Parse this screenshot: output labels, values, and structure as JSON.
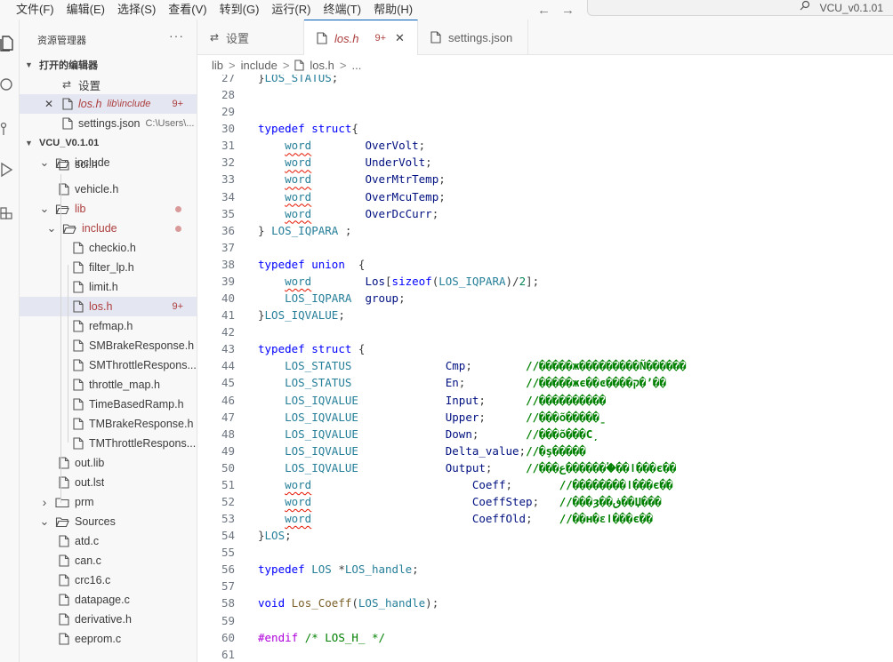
{
  "menu": [
    "文件(F)",
    "编辑(E)",
    "选择(S)",
    "查看(V)",
    "转到(G)",
    "运行(R)",
    "终端(T)",
    "帮助(H)"
  ],
  "nav": {
    "back": "←",
    "forward": "→"
  },
  "command_center": {
    "text": "VCU_v0.1.01"
  },
  "sidebar": {
    "title": "资源管理器",
    "more": "···",
    "open_editors_title": "打开的编辑器",
    "open_editors": [
      {
        "close": "",
        "icon": "gear-icon",
        "name": "设置",
        "desc": "",
        "badge": ""
      },
      {
        "close": "✕",
        "icon": "file-icon",
        "name": "los.h",
        "desc": "lib\\include",
        "badge": "9+"
      },
      {
        "close": "",
        "icon": "file-icon",
        "name": "settings.json",
        "desc": "C:\\Users\\...",
        "badge": ""
      }
    ],
    "project_title": "VCU_V0.1.01",
    "tree": [
      {
        "type": "folder",
        "open": true,
        "level": 1,
        "name": "include",
        "badge": "",
        "dot": false,
        "modified": false,
        "active": false
      },
      {
        "type": "file",
        "level": 2,
        "name": "sci.h",
        "badge": "",
        "modified": false,
        "active": false,
        "clipped": true
      },
      {
        "type": "file",
        "level": 2,
        "name": "vehicle.h",
        "badge": "",
        "modified": false,
        "active": false
      },
      {
        "type": "folder",
        "open": true,
        "level": 1,
        "name": "lib",
        "badge": "",
        "dot": true,
        "modified": true,
        "active": false
      },
      {
        "type": "folder",
        "open": true,
        "level": 2,
        "name": "include",
        "badge": "",
        "dot": true,
        "modified": true,
        "active": false
      },
      {
        "type": "file",
        "level": 3,
        "name": "checkio.h",
        "badge": "",
        "modified": false,
        "active": false
      },
      {
        "type": "file",
        "level": 3,
        "name": "filter_lp.h",
        "badge": "",
        "modified": false,
        "active": false
      },
      {
        "type": "file",
        "level": 3,
        "name": "limit.h",
        "badge": "",
        "modified": false,
        "active": false
      },
      {
        "type": "file",
        "level": 3,
        "name": "los.h",
        "badge": "9+",
        "modified": true,
        "active": true
      },
      {
        "type": "file",
        "level": 3,
        "name": "refmap.h",
        "badge": "",
        "modified": false,
        "active": false
      },
      {
        "type": "file",
        "level": 3,
        "name": "SMBrakeResponse.h",
        "badge": "",
        "modified": false,
        "active": false
      },
      {
        "type": "file",
        "level": 3,
        "name": "SMThrottleRespons...",
        "badge": "",
        "modified": false,
        "active": false
      },
      {
        "type": "file",
        "level": 3,
        "name": "throttle_map.h",
        "badge": "",
        "modified": false,
        "active": false
      },
      {
        "type": "file",
        "level": 3,
        "name": "TimeBasedRamp.h",
        "badge": "",
        "modified": false,
        "active": false
      },
      {
        "type": "file",
        "level": 3,
        "name": "TMBrakeResponse.h",
        "badge": "",
        "modified": false,
        "active": false
      },
      {
        "type": "file",
        "level": 3,
        "name": "TMThrottleRespons...",
        "badge": "",
        "modified": false,
        "active": false
      },
      {
        "type": "file",
        "level": 2,
        "name": "out.lib",
        "badge": "",
        "modified": false,
        "active": false
      },
      {
        "type": "file",
        "level": 2,
        "name": "out.lst",
        "badge": "",
        "modified": false,
        "active": false
      },
      {
        "type": "folder",
        "open": false,
        "level": 1,
        "name": "prm",
        "badge": "",
        "dot": false,
        "modified": false,
        "active": false
      },
      {
        "type": "folder",
        "open": true,
        "level": 1,
        "name": "Sources",
        "badge": "",
        "dot": false,
        "modified": false,
        "active": false
      },
      {
        "type": "file",
        "level": 2,
        "name": "atd.c",
        "badge": "",
        "modified": false,
        "active": false
      },
      {
        "type": "file",
        "level": 2,
        "name": "can.c",
        "badge": "",
        "modified": false,
        "active": false
      },
      {
        "type": "file",
        "level": 2,
        "name": "crc16.c",
        "badge": "",
        "modified": false,
        "active": false
      },
      {
        "type": "file",
        "level": 2,
        "name": "datapage.c",
        "badge": "",
        "modified": false,
        "active": false
      },
      {
        "type": "file",
        "level": 2,
        "name": "derivative.h",
        "badge": "",
        "modified": false,
        "active": false
      },
      {
        "type": "file",
        "level": 2,
        "name": "eeprom.c",
        "badge": "",
        "modified": false,
        "active": false
      }
    ]
  },
  "tabs": [
    {
      "name": "设置",
      "icon": "gear-icon",
      "badge": "",
      "close": "",
      "active": false
    },
    {
      "name": "los.h",
      "icon": "file-icon",
      "badge": "9+",
      "close": "✕",
      "active": true
    },
    {
      "name": "settings.json",
      "icon": "file-icon",
      "badge": "",
      "close": "",
      "active": false
    }
  ],
  "breadcrumb": [
    "lib",
    ">",
    "include",
    ">",
    "los.h",
    ">",
    "..."
  ],
  "code_lines": [
    {
      "n": "27",
      "t": [
        [
          "plain",
          "}"
        ],
        [
          "type",
          "LOS_STATUS"
        ],
        [
          "plain",
          ";"
        ]
      ]
    },
    {
      "n": "28",
      "t": []
    },
    {
      "n": "29",
      "t": []
    },
    {
      "n": "30",
      "t": [
        [
          "kw",
          "typedef"
        ],
        [
          "plain",
          " "
        ],
        [
          "kw",
          "struct"
        ],
        [
          "plain",
          "{"
        ]
      ]
    },
    {
      "n": "31",
      "t": [
        [
          "plain",
          "    "
        ],
        [
          "squig",
          "word"
        ],
        [
          "plain",
          "        "
        ],
        [
          "var",
          "OverVolt"
        ],
        [
          "plain",
          ";"
        ]
      ]
    },
    {
      "n": "32",
      "t": [
        [
          "plain",
          "    "
        ],
        [
          "squig",
          "word"
        ],
        [
          "plain",
          "        "
        ],
        [
          "var",
          "UnderVolt"
        ],
        [
          "plain",
          ";"
        ]
      ]
    },
    {
      "n": "33",
      "t": [
        [
          "plain",
          "    "
        ],
        [
          "squig",
          "word"
        ],
        [
          "plain",
          "        "
        ],
        [
          "var",
          "OverMtrTemp"
        ],
        [
          "plain",
          ";"
        ]
      ]
    },
    {
      "n": "34",
      "t": [
        [
          "plain",
          "    "
        ],
        [
          "squig",
          "word"
        ],
        [
          "plain",
          "        "
        ],
        [
          "var",
          "OverMcuTemp"
        ],
        [
          "plain",
          ";"
        ]
      ]
    },
    {
      "n": "35",
      "t": [
        [
          "plain",
          "    "
        ],
        [
          "squig",
          "word"
        ],
        [
          "plain",
          "        "
        ],
        [
          "var",
          "OverDcCurr"
        ],
        [
          "plain",
          ";"
        ]
      ]
    },
    {
      "n": "36",
      "t": [
        [
          "plain",
          "} "
        ],
        [
          "type",
          "LOS_IQPARA"
        ],
        [
          "plain",
          " ;"
        ]
      ]
    },
    {
      "n": "37",
      "t": []
    },
    {
      "n": "38",
      "t": [
        [
          "kw",
          "typedef"
        ],
        [
          "plain",
          " "
        ],
        [
          "kw",
          "union"
        ],
        [
          "plain",
          "  {"
        ]
      ]
    },
    {
      "n": "39",
      "t": [
        [
          "plain",
          "    "
        ],
        [
          "squig",
          "word"
        ],
        [
          "plain",
          "        "
        ],
        [
          "var",
          "Los"
        ],
        [
          "plain",
          "["
        ],
        [
          "kw",
          "sizeof"
        ],
        [
          "plain",
          "("
        ],
        [
          "type",
          "LOS_IQPARA"
        ],
        [
          "plain",
          ")/"
        ],
        [
          "num",
          "2"
        ],
        [
          "plain",
          "];"
        ]
      ]
    },
    {
      "n": "40",
      "t": [
        [
          "plain",
          "    "
        ],
        [
          "type",
          "LOS_IQPARA"
        ],
        [
          "plain",
          "  "
        ],
        [
          "var",
          "group"
        ],
        [
          "plain",
          ";"
        ]
      ]
    },
    {
      "n": "41",
      "t": [
        [
          "plain",
          "}"
        ],
        [
          "type",
          "LOS_IQVALUE"
        ],
        [
          "plain",
          ";"
        ]
      ]
    },
    {
      "n": "42",
      "t": []
    },
    {
      "n": "43",
      "t": [
        [
          "kw",
          "typedef"
        ],
        [
          "plain",
          " "
        ],
        [
          "kw",
          "struct"
        ],
        [
          "plain",
          " {"
        ]
      ]
    },
    {
      "n": "44",
      "t": [
        [
          "plain",
          "    "
        ],
        [
          "type",
          "LOS_STATUS"
        ],
        [
          "plain",
          "              "
        ],
        [
          "var",
          "Cmp"
        ],
        [
          "plain",
          ";        "
        ],
        [
          "cmtb",
          "//�����ж���������Ñ������"
        ]
      ]
    },
    {
      "n": "45",
      "t": [
        [
          "plain",
          "    "
        ],
        [
          "type",
          "LOS_STATUS"
        ],
        [
          "plain",
          "              "
        ],
        [
          "var",
          "En"
        ],
        [
          "plain",
          ";         "
        ],
        [
          "cmtb",
          "//�����жϵ��ͼ����ק�’��"
        ]
      ]
    },
    {
      "n": "46",
      "t": [
        [
          "plain",
          "    "
        ],
        [
          "type",
          "LOS_IQVALUE"
        ],
        [
          "plain",
          "             "
        ],
        [
          "var",
          "Input"
        ],
        [
          "plain",
          ";      "
        ],
        [
          "cmtb",
          "//����������"
        ]
      ]
    },
    {
      "n": "47",
      "t": [
        [
          "plain",
          "    "
        ],
        [
          "type",
          "LOS_IQVALUE"
        ],
        [
          "plain",
          "             "
        ],
        [
          "var",
          "Upper"
        ],
        [
          "plain",
          ";      "
        ],
        [
          "cmtb",
          "//���õ�����ˍ"
        ]
      ]
    },
    {
      "n": "48",
      "t": [
        [
          "plain",
          "    "
        ],
        [
          "type",
          "LOS_IQVALUE"
        ],
        [
          "plain",
          "             "
        ],
        [
          "var",
          "Down"
        ],
        [
          "plain",
          ";       "
        ],
        [
          "cmtb",
          "//���õ���С̦"
        ]
      ]
    },
    {
      "n": "49",
      "t": [
        [
          "plain",
          "    "
        ],
        [
          "type",
          "LOS_IQVALUE"
        ],
        [
          "plain",
          "             "
        ],
        [
          "var",
          "Delta_value"
        ],
        [
          "plain",
          ";"
        ],
        [
          "cmtb",
          "//�ş�����"
        ]
      ]
    },
    {
      "n": "50",
      "t": [
        [
          "plain",
          "    "
        ],
        [
          "type",
          "LOS_IQVALUE"
        ],
        [
          "plain",
          "             "
        ],
        [
          "var",
          "Output"
        ],
        [
          "plain",
          ";     "
        ],
        [
          "cmtb",
          "//���ع�������ؙ��ǀ���є��"
        ]
      ]
    },
    {
      "n": "51",
      "t": [
        [
          "plain",
          "    "
        ],
        [
          "squig",
          "word"
        ],
        [
          "plain",
          "                        "
        ],
        [
          "var",
          "Coeff"
        ],
        [
          "plain",
          ";       "
        ],
        [
          "cmtb",
          "//��������ǀ���є��"
        ]
      ]
    },
    {
      "n": "52",
      "t": [
        [
          "plain",
          "    "
        ],
        [
          "squig",
          "word"
        ],
        [
          "plain",
          "                        "
        ],
        [
          "var",
          "CoeffStep"
        ],
        [
          "plain",
          ";   "
        ],
        [
          "cmtb",
          "//���ȝ��ڧ��Џ���"
        ]
      ]
    },
    {
      "n": "53",
      "t": [
        [
          "plain",
          "    "
        ],
        [
          "squig",
          "word"
        ],
        [
          "plain",
          "                        "
        ],
        [
          "var",
          "CoeffOld"
        ],
        [
          "plain",
          ";    "
        ],
        [
          "cmtb",
          "//��ʜ�ɛǀ���є��"
        ]
      ]
    },
    {
      "n": "54",
      "t": [
        [
          "plain",
          "}"
        ],
        [
          "type",
          "LOS"
        ],
        [
          "plain",
          ";"
        ]
      ]
    },
    {
      "n": "55",
      "t": []
    },
    {
      "n": "56",
      "t": [
        [
          "kw",
          "typedef"
        ],
        [
          "plain",
          " "
        ],
        [
          "type",
          "LOS"
        ],
        [
          "plain",
          " *"
        ],
        [
          "type",
          "LOS_handle"
        ],
        [
          "plain",
          ";"
        ]
      ]
    },
    {
      "n": "57",
      "t": []
    },
    {
      "n": "58",
      "t": [
        [
          "kw",
          "void"
        ],
        [
          "plain",
          " "
        ],
        [
          "fn",
          "Los_Coeff"
        ],
        [
          "plain",
          "("
        ],
        [
          "type",
          "LOS_handle"
        ],
        [
          "plain",
          ");"
        ]
      ]
    },
    {
      "n": "59",
      "t": []
    },
    {
      "n": "60",
      "t": [
        [
          "pp",
          "#endif"
        ],
        [
          "plain",
          " "
        ],
        [
          "cmt",
          "/* LOS_H_ */"
        ]
      ]
    },
    {
      "n": "61",
      "t": []
    }
  ],
  "colors": {
    "accent": "#005fb8",
    "modified": "#ad3e3e",
    "keyword": "#0000ff",
    "type": "#267f99",
    "comment": "#008000"
  }
}
